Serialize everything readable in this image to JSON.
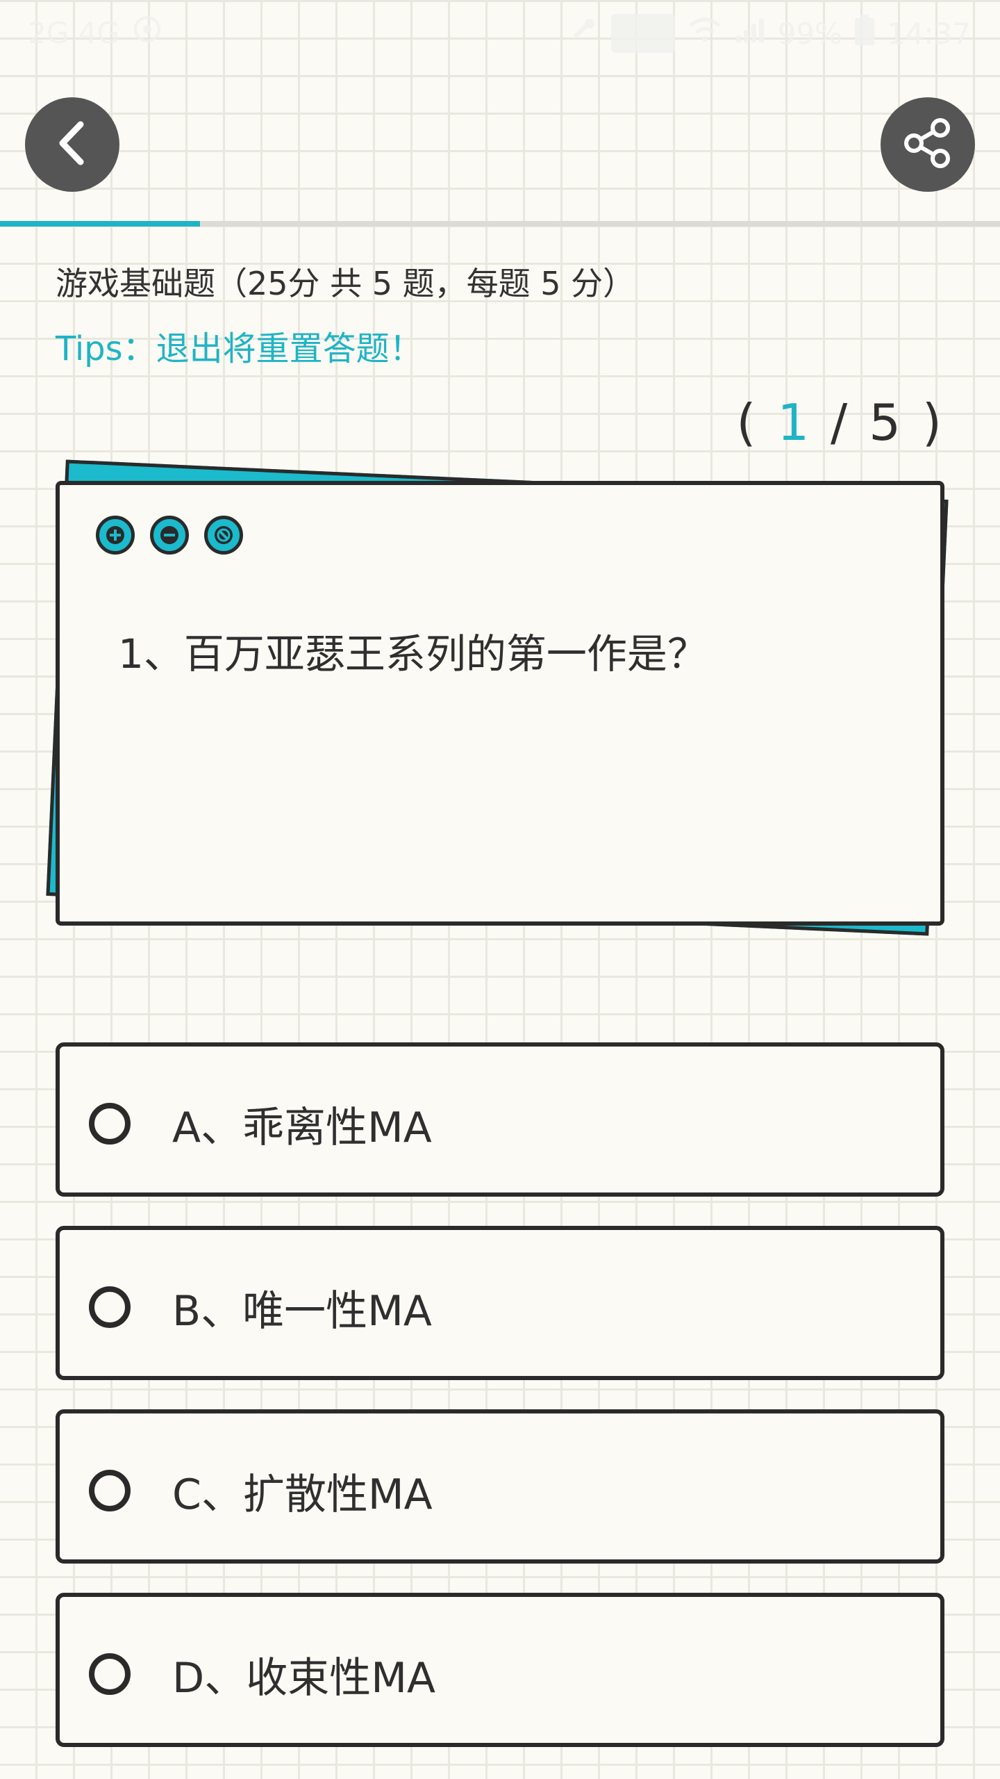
{
  "status_bar": {
    "carrier": "2G 4G",
    "battery": "99%",
    "time": "14:37"
  },
  "header": {
    "back_icon": "chevron-left-icon",
    "share_icon": "share-icon"
  },
  "progress": {
    "fraction": 0.2
  },
  "quiz": {
    "title": "游戏基础题（25分 共 5 题，每题 5 分）",
    "tips": "Tips：退出将重置答题！",
    "counter_open": "(",
    "counter_current": "1",
    "counter_sep": "/",
    "counter_total": "5",
    "counter_close": ")",
    "question": "1、百万亚瑟王系列的第一作是？",
    "options": [
      {
        "label": "A、乖离性MA"
      },
      {
        "label": "B、唯一性MA"
      },
      {
        "label": "C、扩散性MA"
      },
      {
        "label": "D、收束性MA"
      }
    ]
  },
  "colors": {
    "accent": "#1fb4c5",
    "ink": "#2a2a2a",
    "button_bg": "#555555",
    "paper": "#fbfaf4"
  }
}
